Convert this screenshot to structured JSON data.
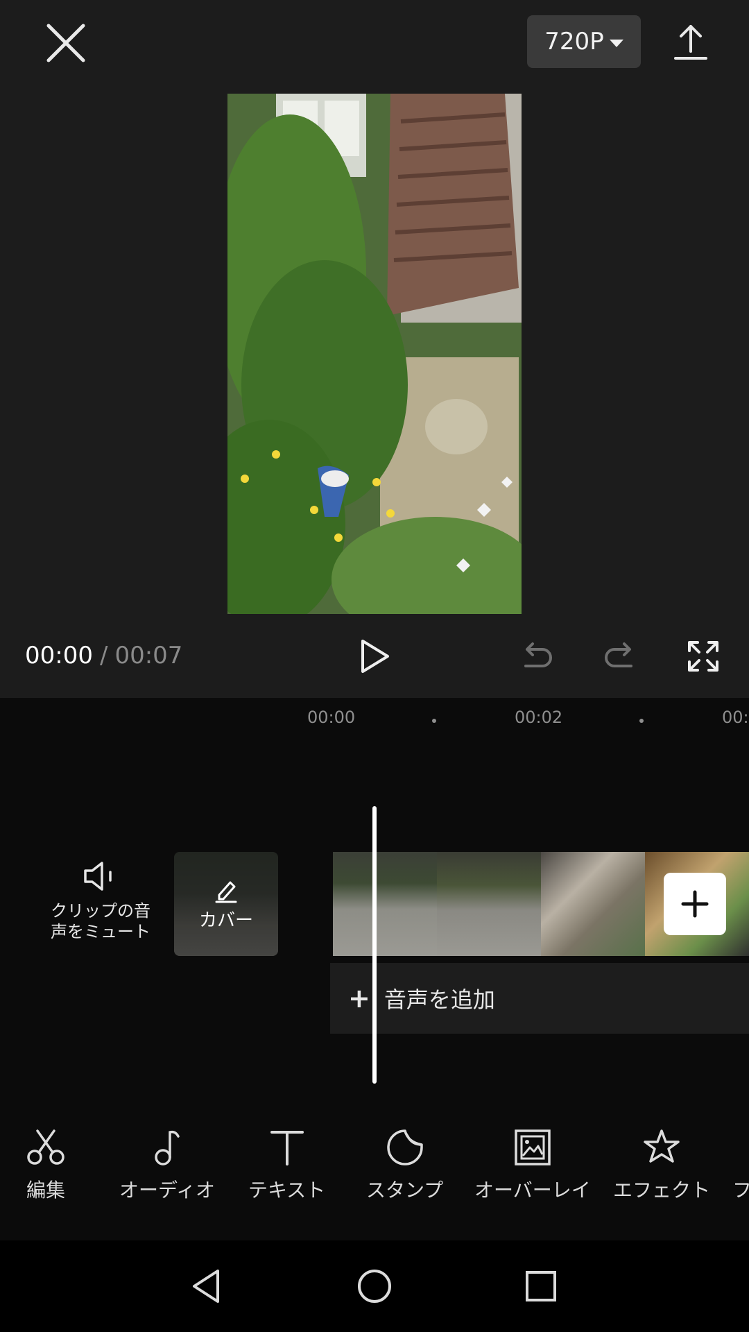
{
  "header": {
    "resolution_label": "720P",
    "icons": [
      "close-icon",
      "caret-down-icon",
      "export-icon"
    ]
  },
  "preview": {
    "description_colors": [
      "#5f7a46",
      "#3f6a2d",
      "#6c7b5a"
    ]
  },
  "playback": {
    "current_time": "00:00",
    "separator": "/",
    "total_time": "00:07"
  },
  "timeline": {
    "ruler": {
      "labels": [
        "00:00",
        "00:02",
        "00:"
      ]
    },
    "mute_label": "クリップの音\n声をミュート",
    "cover_label": "カバー",
    "add_audio_plus": "+",
    "add_audio_label": "音声を追加"
  },
  "toolbar": {
    "items": [
      {
        "label": "編集",
        "icon": "scissors-icon"
      },
      {
        "label": "オーディオ",
        "icon": "music-note-icon"
      },
      {
        "label": "テキスト",
        "icon": "text-icon"
      },
      {
        "label": "スタンプ",
        "icon": "sticker-icon"
      },
      {
        "label": "オーバーレイ",
        "icon": "overlay-icon"
      },
      {
        "label": "エフェクト",
        "icon": "effect-star-icon"
      },
      {
        "label": "フ",
        "icon": ""
      }
    ]
  },
  "colors": {
    "editor_bg": "#1c1c1c",
    "timeline_bg": "#0b0b0b",
    "accent_white": "#ffffff",
    "muted_text": "#8a8a8a"
  }
}
